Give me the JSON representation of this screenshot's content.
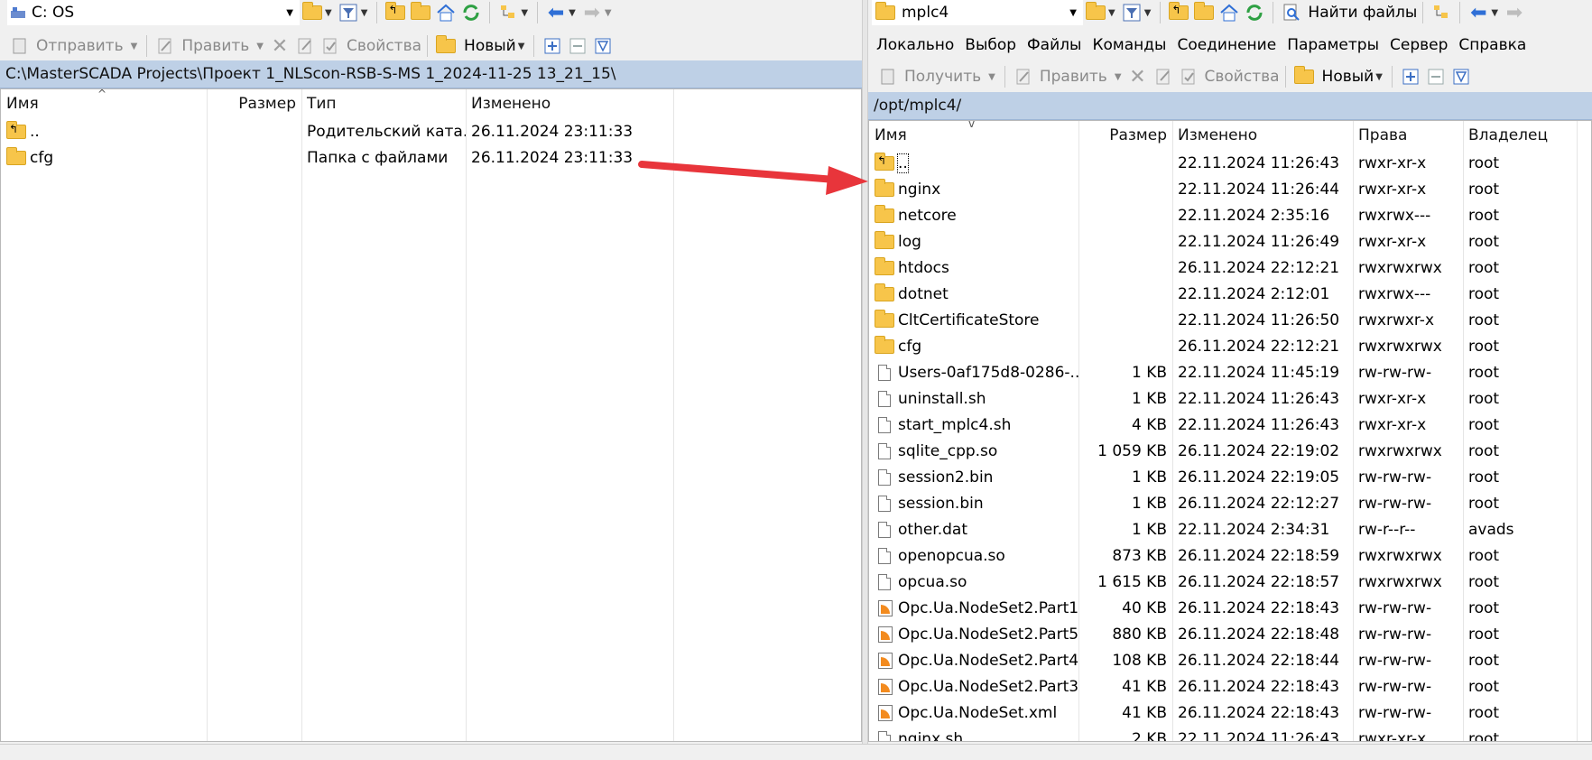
{
  "left": {
    "drive": "C: OS",
    "toolbar": {
      "upload": "Отправить",
      "edit": "Править",
      "properties": "Свойства",
      "new": "Новый"
    },
    "path": "C:\\MasterSCADA Projects\\Проект 1_NLScon-RSB-S-MS 1_2024-11-25 13_21_15\\",
    "columns": {
      "name": "Имя",
      "size": "Размер",
      "type": "Тип",
      "modified": "Изменено"
    },
    "rows": [
      {
        "name": "..",
        "size": "",
        "type": "Родительский ката...",
        "modified": "26.11.2024  23:11:33",
        "icon": "parent-folder-icon"
      },
      {
        "name": "cfg",
        "size": "",
        "type": "Папка с файлами",
        "modified": "26.11.2024  23:11:33",
        "icon": "folder-icon"
      }
    ]
  },
  "right": {
    "drive": "mplc4",
    "find": "Найти файлы",
    "menu": [
      "Локально",
      "Выбор",
      "Файлы",
      "Команды",
      "Соединение",
      "Параметры",
      "Сервер",
      "Справка"
    ],
    "toolbar": {
      "download": "Получить",
      "edit": "Править",
      "properties": "Свойства",
      "new": "Новый"
    },
    "path": "/opt/mplc4/",
    "columns": {
      "name": "Имя",
      "size": "Размер",
      "modified": "Изменено",
      "rights": "Права",
      "owner": "Владелец"
    },
    "rows": [
      {
        "name": "..",
        "size": "",
        "modified": "22.11.2024 11:26:43",
        "rights": "rwxr-xr-x",
        "owner": "root",
        "icon": "parent-folder-icon"
      },
      {
        "name": "nginx",
        "size": "",
        "modified": "22.11.2024 11:26:44",
        "rights": "rwxr-xr-x",
        "owner": "root",
        "icon": "folder-icon"
      },
      {
        "name": "netcore",
        "size": "",
        "modified": "22.11.2024 2:35:16",
        "rights": "rwxrwx---",
        "owner": "root",
        "icon": "folder-icon"
      },
      {
        "name": "log",
        "size": "",
        "modified": "22.11.2024 11:26:49",
        "rights": "rwxr-xr-x",
        "owner": "root",
        "icon": "folder-icon"
      },
      {
        "name": "htdocs",
        "size": "",
        "modified": "26.11.2024 22:12:21",
        "rights": "rwxrwxrwx",
        "owner": "root",
        "icon": "folder-icon"
      },
      {
        "name": "dotnet",
        "size": "",
        "modified": "22.11.2024 2:12:01",
        "rights": "rwxrwx---",
        "owner": "root",
        "icon": "folder-icon"
      },
      {
        "name": "CltCertificateStore",
        "size": "",
        "modified": "22.11.2024 11:26:50",
        "rights": "rwxrwxr-x",
        "owner": "root",
        "icon": "folder-icon"
      },
      {
        "name": "cfg",
        "size": "",
        "modified": "26.11.2024 22:12:21",
        "rights": "rwxrwxrwx",
        "owner": "root",
        "icon": "folder-icon"
      },
      {
        "name": "Users-0af175d8-0286-...",
        "size": "1 KB",
        "modified": "22.11.2024 11:45:19",
        "rights": "rw-rw-rw-",
        "owner": "root",
        "icon": "file-icon"
      },
      {
        "name": "uninstall.sh",
        "size": "1 KB",
        "modified": "22.11.2024 11:26:43",
        "rights": "rwxr-xr-x",
        "owner": "root",
        "icon": "file-icon"
      },
      {
        "name": "start_mplc4.sh",
        "size": "4 KB",
        "modified": "22.11.2024 11:26:43",
        "rights": "rwxr-xr-x",
        "owner": "root",
        "icon": "file-icon"
      },
      {
        "name": "sqlite_cpp.so",
        "size": "1 059 KB",
        "modified": "26.11.2024 22:19:02",
        "rights": "rwxrwxrwx",
        "owner": "root",
        "icon": "file-icon"
      },
      {
        "name": "session2.bin",
        "size": "1 KB",
        "modified": "26.11.2024 22:19:05",
        "rights": "rw-rw-rw-",
        "owner": "root",
        "icon": "file-icon"
      },
      {
        "name": "session.bin",
        "size": "1 KB",
        "modified": "26.11.2024 22:12:27",
        "rights": "rw-rw-rw-",
        "owner": "root",
        "icon": "file-icon"
      },
      {
        "name": "other.dat",
        "size": "1 KB",
        "modified": "22.11.2024 2:34:31",
        "rights": "rw-r--r--",
        "owner": "avads",
        "icon": "file-icon"
      },
      {
        "name": "openopcua.so",
        "size": "873 KB",
        "modified": "26.11.2024 22:18:59",
        "rights": "rwxrwxrwx",
        "owner": "root",
        "icon": "file-icon"
      },
      {
        "name": "opcua.so",
        "size": "1 615 KB",
        "modified": "26.11.2024 22:18:57",
        "rights": "rwxrwxrwx",
        "owner": "root",
        "icon": "file-icon"
      },
      {
        "name": "Opc.Ua.NodeSet2.Part1...",
        "size": "40 KB",
        "modified": "26.11.2024 22:18:43",
        "rights": "rw-rw-rw-",
        "owner": "root",
        "icon": "xml-icon"
      },
      {
        "name": "Opc.Ua.NodeSet2.Part5...",
        "size": "880 KB",
        "modified": "26.11.2024 22:18:48",
        "rights": "rw-rw-rw-",
        "owner": "root",
        "icon": "xml-icon"
      },
      {
        "name": "Opc.Ua.NodeSet2.Part4...",
        "size": "108 KB",
        "modified": "26.11.2024 22:18:44",
        "rights": "rw-rw-rw-",
        "owner": "root",
        "icon": "xml-icon"
      },
      {
        "name": "Opc.Ua.NodeSet2.Part3...",
        "size": "41 KB",
        "modified": "26.11.2024 22:18:43",
        "rights": "rw-rw-rw-",
        "owner": "root",
        "icon": "xml-icon"
      },
      {
        "name": "Opc.Ua.NodeSet.xml",
        "size": "41 KB",
        "modified": "26.11.2024 22:18:43",
        "rights": "rw-rw-rw-",
        "owner": "root",
        "icon": "xml-icon"
      },
      {
        "name": "nginx.sh",
        "size": "2 KB",
        "modified": "22.11.2024 11:26:43",
        "rights": "rwxr-xr-x",
        "owner": "root",
        "icon": "file-icon"
      }
    ]
  },
  "colors": {
    "path_bar": "#bed0e6",
    "arrow": "#e8353b",
    "folder": "#f7c54a"
  }
}
